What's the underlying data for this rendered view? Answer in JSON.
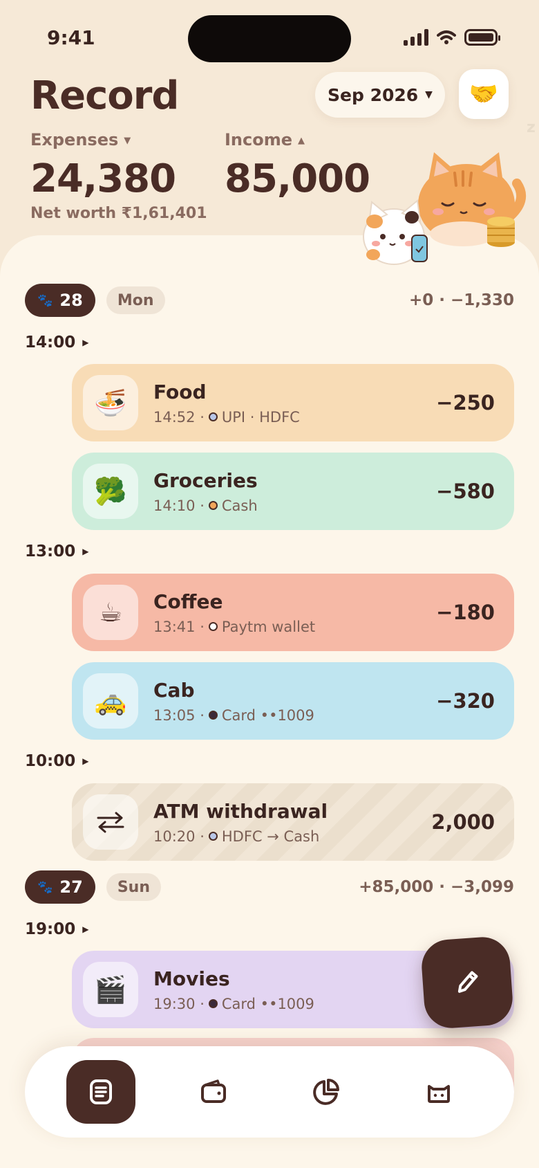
{
  "status": {
    "time": "9:41"
  },
  "header": {
    "title": "Record",
    "month": "Sep 2026",
    "expenses_label": "Expenses",
    "expenses_value": "24,380",
    "income_label": "Income",
    "income_value": "85,000",
    "net_worth": "Net worth ₹1,61,401"
  },
  "days": [
    {
      "date": "28",
      "weekday": "Mon",
      "total": "+0 · −1,330",
      "groups": [
        {
          "time": "14:00",
          "items": [
            {
              "name": "Food",
              "time": "14:52 ·",
              "method": "UPI · HDFC",
              "amount": "−250"
            },
            {
              "name": "Groceries",
              "time": "14:10 ·",
              "method": "Cash",
              "amount": "−580"
            }
          ]
        },
        {
          "time": "13:00",
          "items": [
            {
              "name": "Coffee",
              "time": "13:41 ·",
              "method": "Paytm wallet",
              "amount": "−180"
            },
            {
              "name": "Cab",
              "time": "13:05 ·",
              "method": "Card ••1009",
              "amount": "−320"
            }
          ]
        },
        {
          "time": "10:00",
          "items": [
            {
              "name": "ATM withdrawal",
              "time": "10:20 ·",
              "method": "HDFC → Cash",
              "amount": "2,000"
            }
          ]
        }
      ]
    },
    {
      "date": "27",
      "weekday": "Sun",
      "total": "+85,000 · −3,099",
      "groups": [
        {
          "time": "19:00",
          "items": [
            {
              "name": "Movies",
              "time": "19:30 ·",
              "method": "Card ••1009",
              "amount": ""
            }
          ]
        }
      ]
    }
  ],
  "icons": {
    "food": "noodle-bowl-icon",
    "groceries": "broccoli-icon",
    "coffee": "coffee-cup-icon",
    "cab": "taxi-icon",
    "atm": "transfer-arrows-icon",
    "movies": "clapperboard-icon"
  },
  "colors": {
    "brand": "#4a2c26",
    "background": "#f6e9d7",
    "sheet": "#fdf6ea",
    "food": "#f8dcb6",
    "groceries": "#cdeddb",
    "coffee": "#f6b9a6",
    "cab": "#bfe5f0",
    "movies": "#e3d5f2"
  }
}
